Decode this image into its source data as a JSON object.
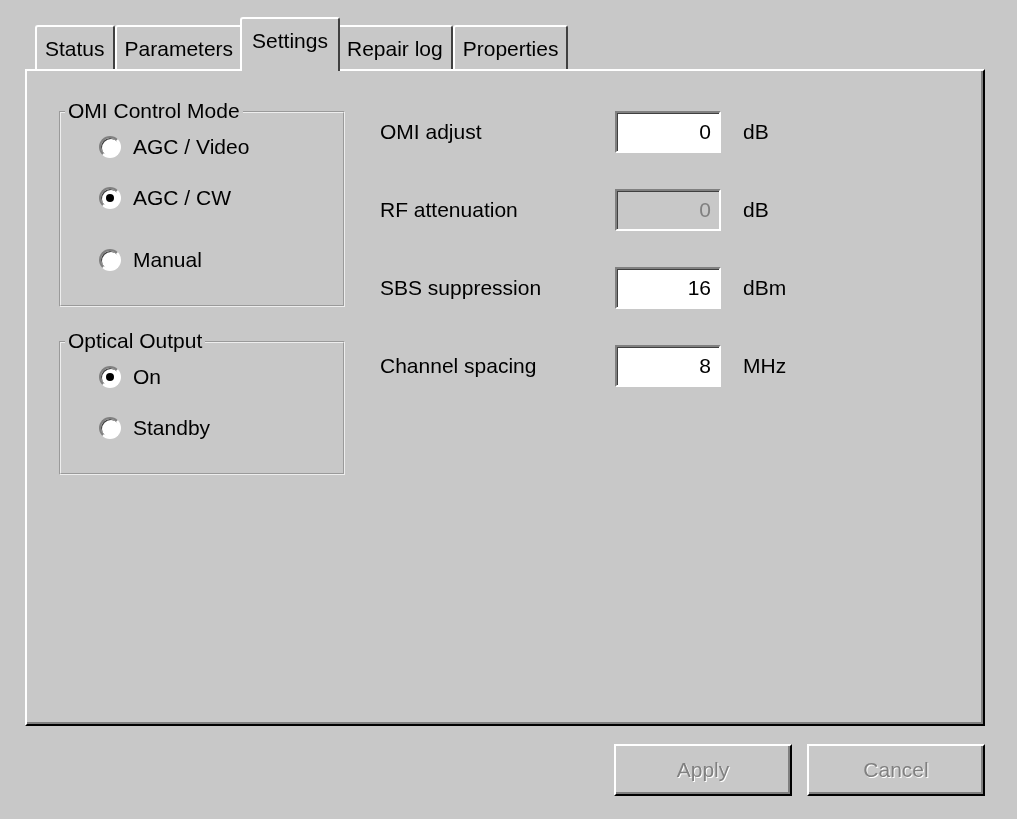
{
  "tabs": [
    {
      "label": "Status",
      "selected": false
    },
    {
      "label": "Parameters",
      "selected": false
    },
    {
      "label": "Settings",
      "selected": true
    },
    {
      "label": "Repair log",
      "selected": false
    },
    {
      "label": "Properties",
      "selected": false
    }
  ],
  "groups": [
    {
      "title": "OMI Control Mode",
      "options": [
        {
          "label": "AGC / Video",
          "selected": false
        },
        {
          "label": "AGC / CW",
          "selected": true
        },
        {
          "label": "Manual",
          "selected": false
        }
      ]
    },
    {
      "title": "Optical Output",
      "options": [
        {
          "label": "On",
          "selected": true
        },
        {
          "label": "Standby",
          "selected": false
        }
      ]
    }
  ],
  "fields": [
    {
      "label": "OMI adjust",
      "value": "0",
      "unit": "dB",
      "disabled": false
    },
    {
      "label": "RF attenuation",
      "value": "0",
      "unit": "dB",
      "disabled": true
    },
    {
      "label": "SBS suppression",
      "value": "16",
      "unit": "dBm",
      "disabled": false
    },
    {
      "label": "Channel spacing",
      "value": "8",
      "unit": "MHz",
      "disabled": false
    }
  ],
  "buttons": [
    {
      "label": "Apply",
      "disabled": true
    },
    {
      "label": "Cancel",
      "disabled": true
    }
  ]
}
